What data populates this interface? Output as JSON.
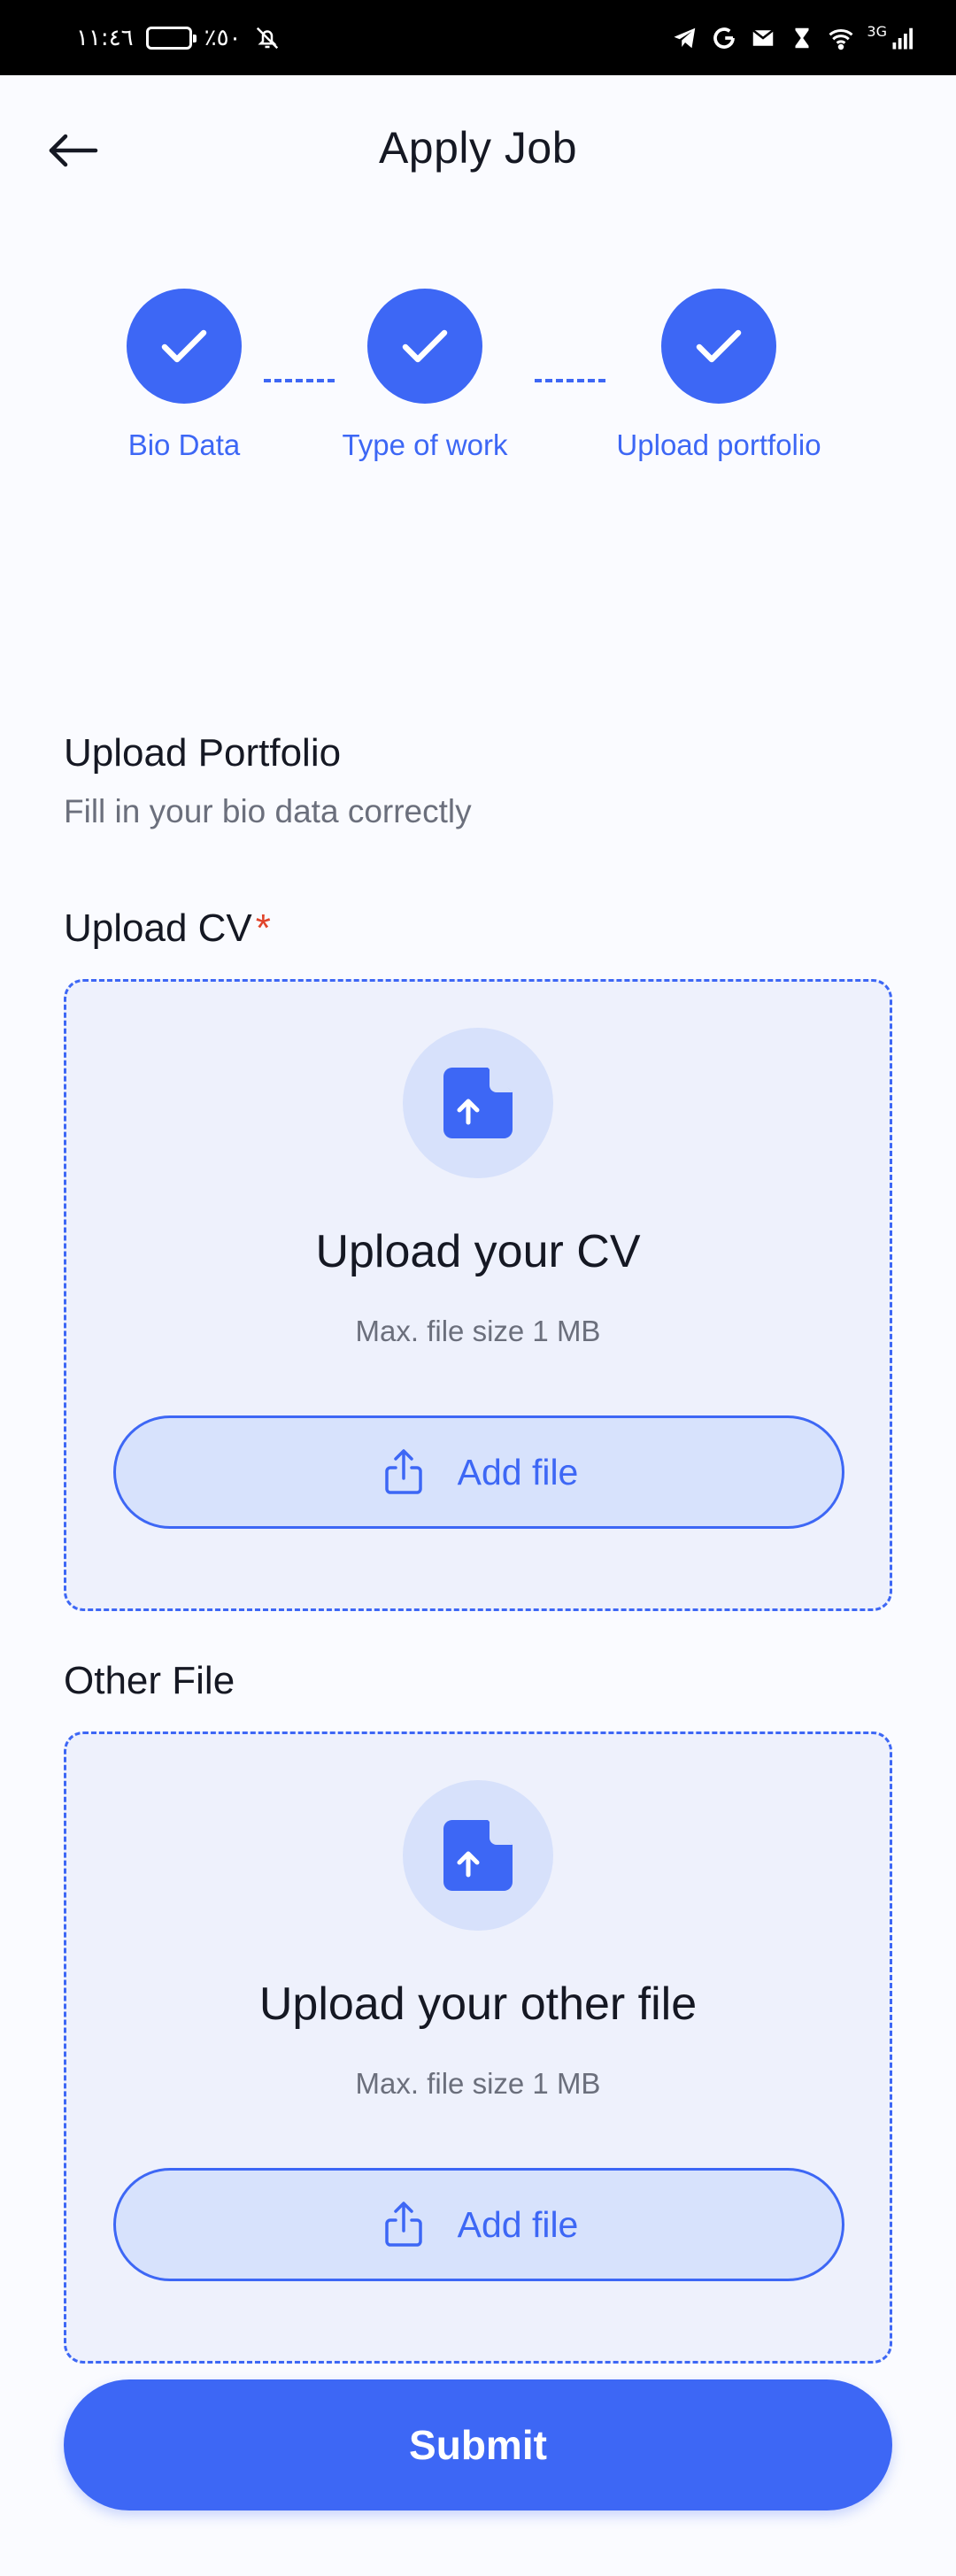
{
  "status_bar": {
    "time": "١١:٤٦",
    "battery": "٪٥٠",
    "network": "3G"
  },
  "header": {
    "title": "Apply Job"
  },
  "stepper": {
    "steps": [
      {
        "label": "Bio Data",
        "completed": true
      },
      {
        "label": "Type of work",
        "completed": true
      },
      {
        "label": "Upload portfolio",
        "completed": true
      }
    ]
  },
  "section": {
    "title": "Upload Portfolio",
    "subtitle": "Fill in your bio data correctly"
  },
  "cv_upload": {
    "label": "Upload CV",
    "required_mark": "*",
    "title": "Upload your CV",
    "hint": "Max. file size 1 MB",
    "button_label": "Add file"
  },
  "other_upload": {
    "label": "Other File",
    "title": "Upload your other file",
    "hint": "Max. file size 1 MB",
    "button_label": "Add file"
  },
  "submit": {
    "label": "Submit"
  },
  "colors": {
    "accent": "#3d67f5",
    "box_bg": "#eef1fc",
    "icon_bg": "#d7e1fb",
    "required": "#e0442b"
  }
}
